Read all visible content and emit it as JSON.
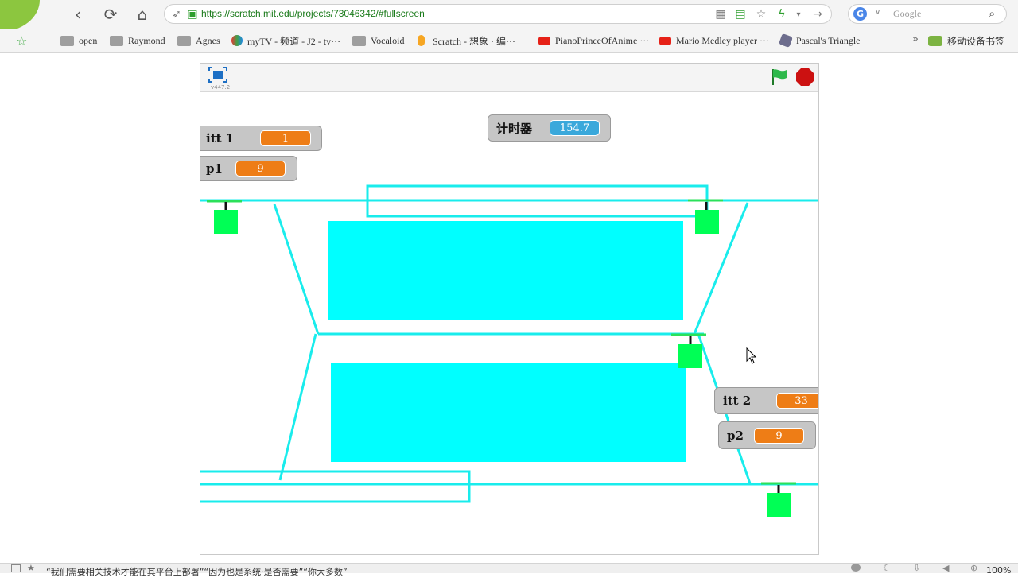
{
  "browser": {
    "url": "https://scratch.mit.edu/projects/73046342/#fullscreen",
    "search_placeholder": "Google",
    "bookmarks": [
      {
        "label": "open",
        "icon": "folder-icon"
      },
      {
        "label": "Raymond",
        "icon": "folder-icon"
      },
      {
        "label": "Agnes",
        "icon": "folder-icon"
      },
      {
        "label": "myTV - 频道 - J2 - tv···",
        "icon": "mytv-icon"
      },
      {
        "label": "Vocaloid",
        "icon": "folder-icon"
      },
      {
        "label": "Scratch - 想象 · 编···",
        "icon": "scratch-icon"
      },
      {
        "label": "PianoPrinceOfAnime ···",
        "icon": "youtube-icon"
      },
      {
        "label": "Mario Medley player ···",
        "icon": "youtube-icon"
      },
      {
        "label": "Pascal's Triangle",
        "icon": "pascal-icon"
      },
      {
        "label": "移动设备书签",
        "icon": "cloud-folder-icon"
      }
    ],
    "bookmarks_overflow": "»"
  },
  "scratch": {
    "version": "v447.2",
    "monitors": {
      "itt1": {
        "label": "itt 1",
        "value": "1"
      },
      "p1": {
        "label": "p1",
        "value": "9"
      },
      "timer": {
        "label": "计时器",
        "value": "154.7"
      },
      "itt2": {
        "label": "itt 2",
        "value": "33"
      },
      "p2": {
        "label": "p2",
        "value": "9"
      }
    },
    "colors": {
      "track": "#00ffff",
      "platform": "#00ffff",
      "train": "#00ff55",
      "orange_value": "#ee7d16",
      "blue_value": "#3aa8db",
      "stop": "#cc0000",
      "flag": "#22aa33"
    }
  },
  "status_bar": {
    "text": "“我们需要相关技术才能在其平台上部署”“因为也是系统·是否需要”“你大多数”",
    "zoom": "100%"
  }
}
